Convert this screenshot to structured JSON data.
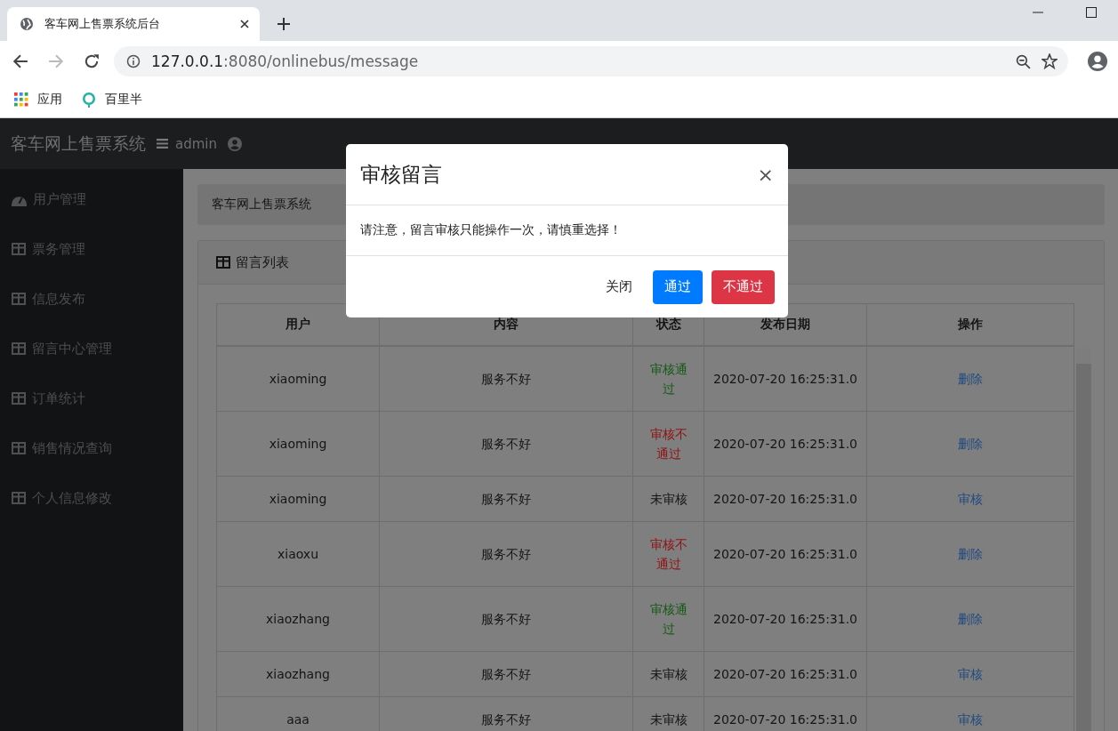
{
  "browser": {
    "tab_title": "客车网上售票系统后台",
    "url_host": "127.0.0.1",
    "url_rest": ":8080/onlinebus/message",
    "bookmarks": [
      "应用",
      "百里半"
    ]
  },
  "navbar": {
    "brand": "客车网上售票系统",
    "user": "admin"
  },
  "sidebar": {
    "items": [
      {
        "label": "用户管理",
        "kind": "dashboard"
      },
      {
        "label": "票务管理",
        "kind": "table"
      },
      {
        "label": "信息发布",
        "kind": "table"
      },
      {
        "label": "留言中心管理",
        "kind": "table"
      },
      {
        "label": "订单统计",
        "kind": "table"
      },
      {
        "label": "销售情况查询",
        "kind": "table"
      },
      {
        "label": "个人信息修改",
        "kind": "table"
      }
    ]
  },
  "breadcrumb": "客车网上售票系统",
  "card": {
    "title": "留言列表"
  },
  "table": {
    "columns": [
      "用户",
      "内容",
      "状态",
      "发布日期",
      "操作"
    ],
    "rows": [
      {
        "user": "xiaoming",
        "content": "服务不好",
        "status": "审核通过",
        "color": "#145a14",
        "date": "2020-07-20 16:25:31.0",
        "action": "删除"
      },
      {
        "user": "xiaoming",
        "content": "服务不好",
        "status": "审核不通过",
        "color": "#8f1010",
        "date": "2020-07-20 16:25:31.0",
        "action": "删除"
      },
      {
        "user": "xiaoming",
        "content": "服务不好",
        "status": "未审核",
        "color": "#141414",
        "date": "2020-07-20 16:25:31.0",
        "action": "审核"
      },
      {
        "user": "xiaoxu",
        "content": "服务不好",
        "status": "审核不通过",
        "color": "#8f1010",
        "date": "2020-07-20 16:25:31.0",
        "action": "删除"
      },
      {
        "user": "xiaozhang",
        "content": "服务不好",
        "status": "审核通过",
        "color": "#145a14",
        "date": "2020-07-20 16:25:31.0",
        "action": "删除"
      },
      {
        "user": "xiaozhang",
        "content": "服务不好",
        "status": "未审核",
        "color": "#141414",
        "date": "2020-07-20 16:25:31.0",
        "action": "审核"
      },
      {
        "user": "aaa",
        "content": "服务不好",
        "status": "未审核",
        "color": "#141414",
        "date": "2020-07-20 16:25:31.0",
        "action": "审核"
      }
    ]
  },
  "modal": {
    "title": "审核留言",
    "close": "×",
    "message": "请注意，留言审核只能操作一次，请慎重选择！",
    "buttons": [
      {
        "label": "关闭",
        "kind": "link"
      },
      {
        "label": "通过",
        "kind": "primary"
      },
      {
        "label": "不通过",
        "kind": "danger"
      }
    ]
  }
}
